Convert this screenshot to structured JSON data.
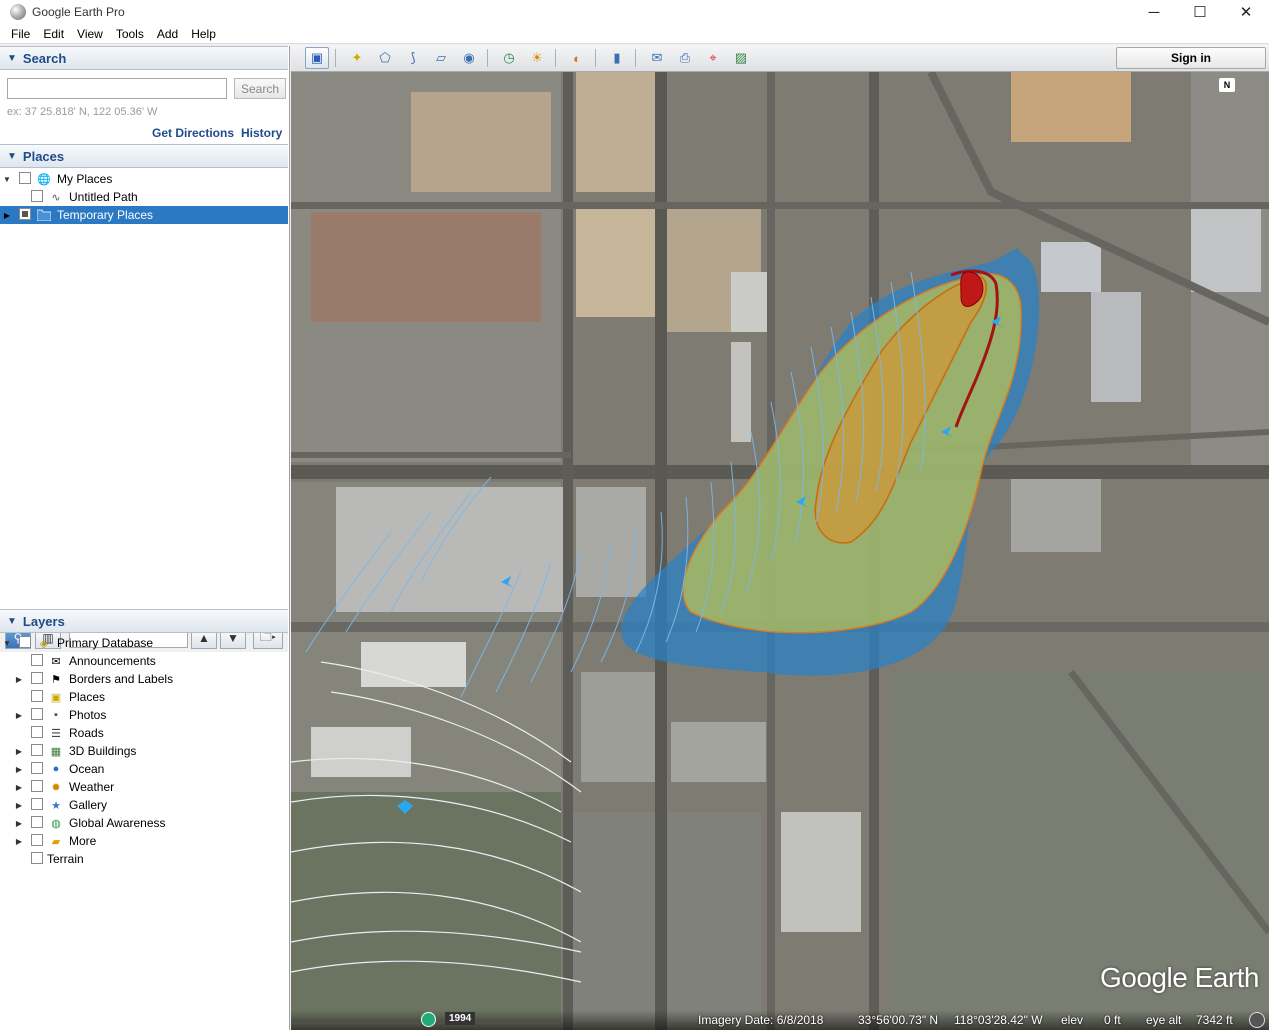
{
  "window": {
    "title": "Google Earth Pro",
    "minimize": "─",
    "maximize": "☐",
    "close": "✕"
  },
  "menu": [
    "File",
    "Edit",
    "View",
    "Tools",
    "Add",
    "Help"
  ],
  "search": {
    "header": "Search",
    "input_value": "",
    "button_label": "Search",
    "hint": "ex: 37 25.818' N, 122 05.36' W",
    "get_directions": "Get Directions",
    "history": "History"
  },
  "places": {
    "header": "Places",
    "items": [
      {
        "label": "My Places",
        "icon": "globe-folder-icon"
      },
      {
        "label": "Untitled Path",
        "icon": "path-icon"
      },
      {
        "label": "Temporary Places",
        "icon": "folder-icon",
        "selected": true
      }
    ]
  },
  "midbar": {
    "search_value": ""
  },
  "layers": {
    "header": "Layers",
    "items": [
      {
        "label": "Primary Database",
        "icon": "database-icon"
      },
      {
        "label": "Announcements",
        "icon": "envelope-icon"
      },
      {
        "label": "Borders and Labels",
        "icon": "flag-icon"
      },
      {
        "label": "Places",
        "icon": "place-icon"
      },
      {
        "label": "Photos",
        "icon": "photo-icon"
      },
      {
        "label": "Roads",
        "icon": "road-icon"
      },
      {
        "label": "3D Buildings",
        "icon": "building-icon"
      },
      {
        "label": "Ocean",
        "icon": "ocean-icon"
      },
      {
        "label": "Weather",
        "icon": "sun-icon"
      },
      {
        "label": "Gallery",
        "icon": "star-icon"
      },
      {
        "label": "Global Awareness",
        "icon": "earth-icon"
      },
      {
        "label": "More",
        "icon": "more-icon"
      },
      {
        "label": "Terrain",
        "icon": "none"
      }
    ]
  },
  "toolbar": {
    "sign_in": "Sign in"
  },
  "map": {
    "compass": "N",
    "logo": "Google Earth",
    "year": "1994",
    "imagery_date": "Imagery Date: 6/8/2018",
    "lat": "33°56'00.73\" N",
    "lon": "118°03'28.42\" W",
    "elev_label": "elev",
    "elev_value": "0 ft",
    "eye_alt_label": "eye alt",
    "eye_alt_value": "7342 ft"
  }
}
